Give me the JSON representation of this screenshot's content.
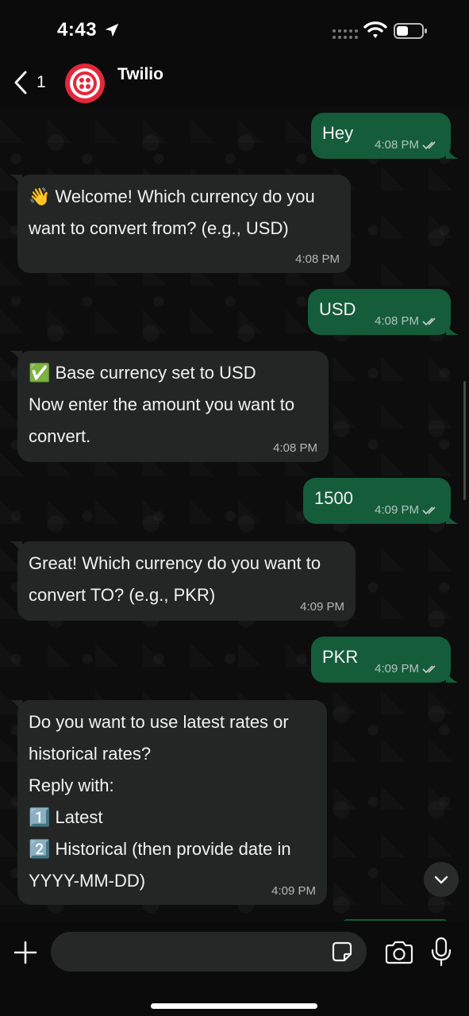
{
  "status_bar": {
    "time": "4:43",
    "icons": [
      "location-arrow-icon",
      "signal-dots-icon",
      "wifi-icon",
      "battery-icon"
    ]
  },
  "header": {
    "back_count": "1",
    "contact_name": "Twilio",
    "avatar_icon": "twilio-logo-icon"
  },
  "colors": {
    "outgoing_bubble": "#155c3a",
    "incoming_bubble": "#242626",
    "avatar_brand": "#e2283b"
  },
  "messages": [
    {
      "direction": "out",
      "text": "Hey",
      "time": "4:08 PM"
    },
    {
      "direction": "in",
      "text": "👋 Welcome! Which currency do you\nwant to convert from? (e.g., USD)",
      "time": "4:08 PM"
    },
    {
      "direction": "out",
      "text": "USD",
      "time": "4:08 PM"
    },
    {
      "direction": "in",
      "text": "✅ Base currency set to USD\nNow enter the amount you want to\nconvert.",
      "time": "4:08 PM"
    },
    {
      "direction": "out",
      "text": "1500",
      "time": "4:09 PM"
    },
    {
      "direction": "in",
      "text": "Great! Which currency do you want to\nconvert TO? (e.g., PKR)",
      "time": "4:09 PM"
    },
    {
      "direction": "out",
      "text": "PKR",
      "time": "4:09 PM"
    },
    {
      "direction": "in",
      "text": "Do you want to use latest rates or\nhistorical rates?\nReply with:\n1️⃣ Latest\n2️⃣ Historical (then provide date in\nYYYY-MM-DD)",
      "time": "4:09 PM"
    }
  ],
  "composer": {
    "placeholder": "",
    "icons": [
      "plus-icon",
      "sticker-icon",
      "camera-icon",
      "microphone-icon"
    ]
  }
}
